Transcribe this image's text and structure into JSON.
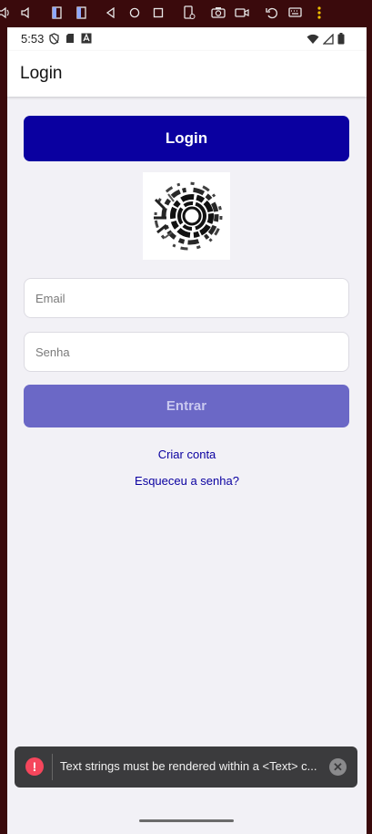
{
  "emulator_toolbar": {
    "buttons": [
      {
        "name": "volume-up-icon"
      },
      {
        "name": "volume-down-icon"
      },
      {
        "name": "rotate-left-icon"
      },
      {
        "name": "rotate-right-icon"
      },
      {
        "name": "back-icon"
      },
      {
        "name": "home-icon"
      },
      {
        "name": "overview-icon"
      },
      {
        "name": "fold-icon"
      },
      {
        "name": "camera-icon"
      },
      {
        "name": "record-icon"
      },
      {
        "name": "undo-icon"
      },
      {
        "name": "keyboard-icon"
      },
      {
        "name": "more-icon"
      }
    ]
  },
  "status_bar": {
    "time": "5:53"
  },
  "header": {
    "title": "Login"
  },
  "banner": {
    "label": "Login"
  },
  "form": {
    "email_placeholder": "Email",
    "email_value": "",
    "password_placeholder": "Senha",
    "password_value": "",
    "submit_label": "Entrar"
  },
  "links": {
    "create_account": "Criar conta",
    "forgot_password": "Esqueceu a senha?"
  },
  "toast": {
    "icon": "!",
    "message": "Text strings must be rendered within a <Text> c..."
  },
  "colors": {
    "primary": "#0a00a0",
    "primary_disabled": "#6b68c6",
    "background": "#f2f1f6",
    "toast_background": "#3b3b3d",
    "error": "#f5465c"
  }
}
